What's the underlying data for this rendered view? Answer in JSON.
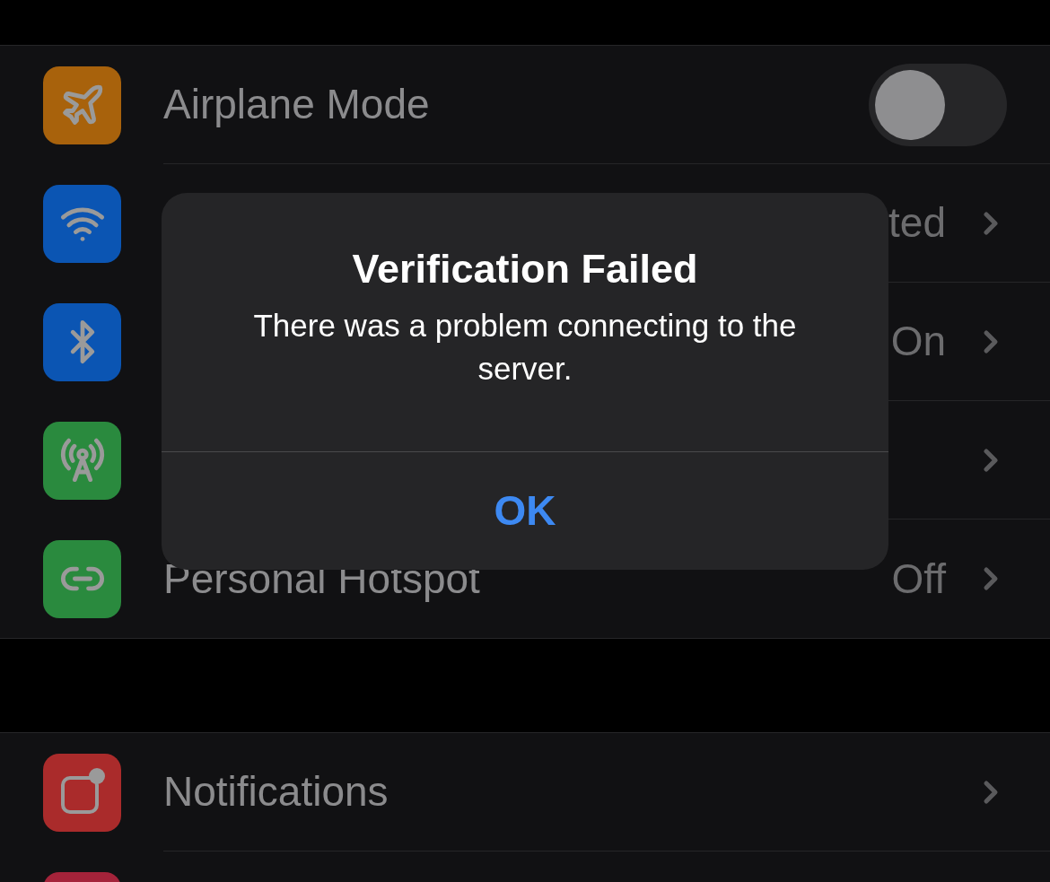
{
  "sections": [
    {
      "rows": [
        {
          "kind": "toggle",
          "label": "Airplane Mode",
          "on": false
        },
        {
          "kind": "link",
          "value": "ted"
        },
        {
          "kind": "link",
          "value": "On"
        },
        {
          "kind": "link"
        },
        {
          "kind": "link",
          "label": "Personal Hotspot",
          "value": "Off"
        }
      ]
    },
    {
      "rows": [
        {
          "kind": "link",
          "label": "Notifications"
        },
        {
          "kind": "partial"
        }
      ]
    }
  ],
  "alert": {
    "title": "Verification Failed",
    "message": "There was a problem connecting to the server.",
    "button": "OK"
  }
}
